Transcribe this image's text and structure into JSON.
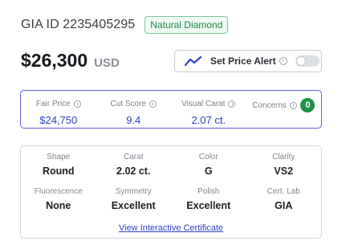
{
  "header": {
    "gia_id": "GIA ID 2235405295",
    "badge": "Natural Diamond"
  },
  "price": {
    "amount": "$26,300",
    "currency": "USD"
  },
  "price_alert": {
    "label": "Set Price Alert",
    "enabled": false
  },
  "scores": [
    {
      "label": "Fair Price",
      "value": "$24,750"
    },
    {
      "label": "Cut Score",
      "value": "9.4"
    },
    {
      "label": "Visual Carat",
      "value": "2.07 ct."
    },
    {
      "label": "Concerns",
      "value": "0"
    }
  ],
  "specs": [
    {
      "label": "Shape",
      "value": "Round"
    },
    {
      "label": "Carat",
      "value": "2.02 ct."
    },
    {
      "label": "Color",
      "value": "G"
    },
    {
      "label": "Clarity",
      "value": "VS2"
    },
    {
      "label": "Fluorescence",
      "value": "None"
    },
    {
      "label": "Symmetry",
      "value": "Excellent"
    },
    {
      "label": "Polish",
      "value": "Excellent"
    },
    {
      "label": "Cert. Lab",
      "value": "GIA"
    }
  ],
  "certificate_link": "View Interactive Certificate",
  "colors": {
    "accent": "#2f41c9",
    "box_border": "#5b5fd6",
    "concerns_green": "#1f9146",
    "badge_green": "#1f8a4c"
  }
}
